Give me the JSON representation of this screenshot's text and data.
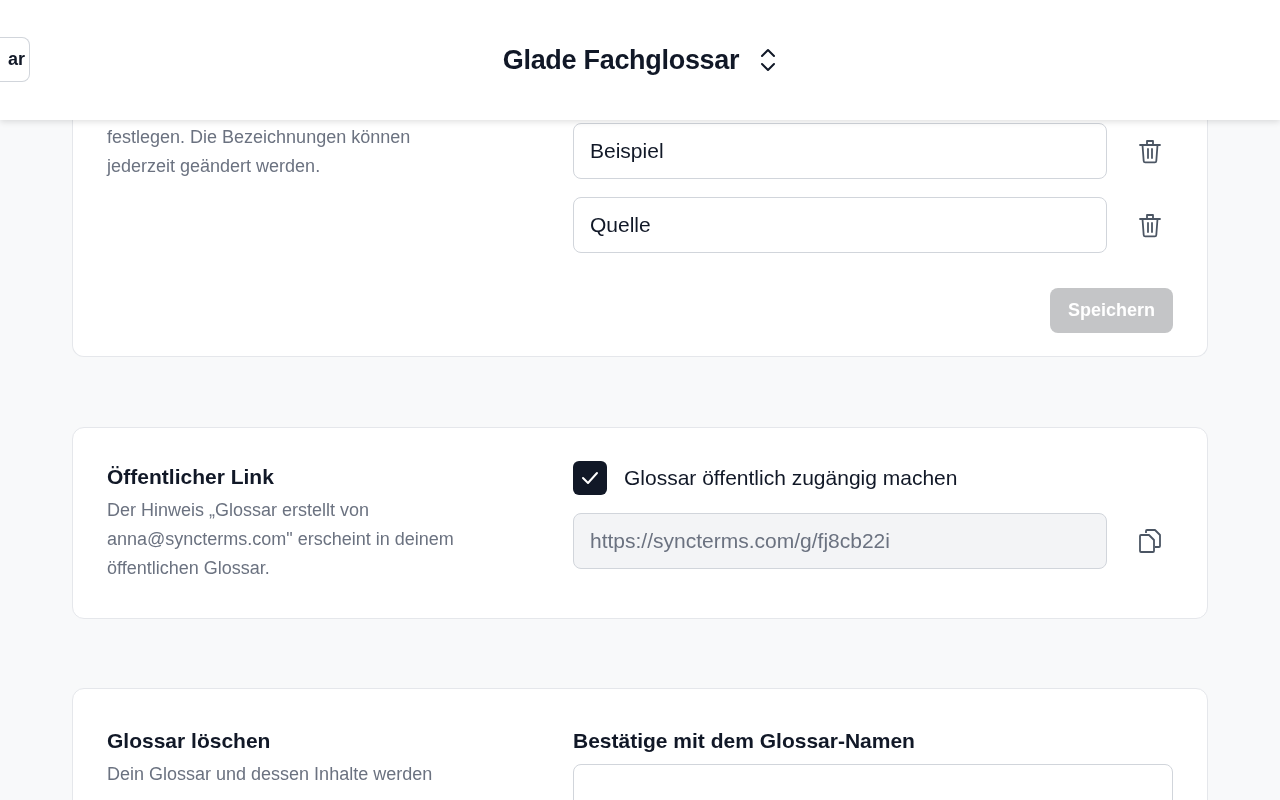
{
  "header": {
    "back_button": "ar",
    "title": "Glade Fachglossar"
  },
  "fields_section": {
    "description": "festlegen. Die Bezeichnungen können jederzeit geändert werden.",
    "fields": [
      {
        "value": "Beispiel"
      },
      {
        "value": "Quelle"
      }
    ],
    "save_button": {
      "label": "Speichern",
      "disabled": true
    }
  },
  "public_link": {
    "title": "Öffentlicher Link",
    "description": "Der Hinweis „Glossar erstellt von anna@syncterms.com\" erscheint in deinem öffentlichen Glossar.",
    "checkbox": {
      "label": "Glossar öffentlich zugängig machen",
      "checked": true
    },
    "url": "https://syncterms.com/g/fj8cb22i"
  },
  "delete_section": {
    "title": "Glossar löschen",
    "description": "Dein Glossar und dessen Inhalte werden",
    "confirm_label": "Bestätige mit dem Glossar-Namen"
  }
}
